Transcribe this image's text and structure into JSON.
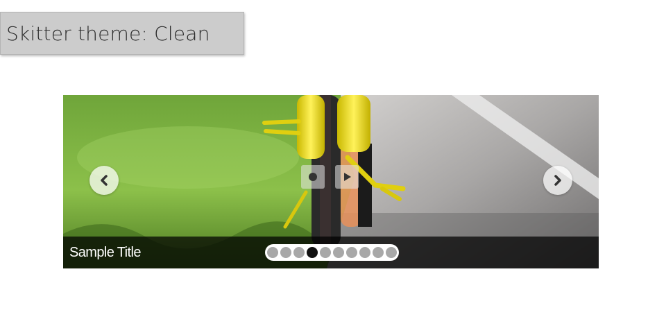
{
  "header": {
    "theme_label": "Skitter theme: Clean"
  },
  "slider": {
    "caption_title": "Sample Title",
    "slide_count": 10,
    "active_slide": 4,
    "icons": {
      "prev": "chevron-left-icon",
      "next": "chevron-right-icon",
      "pause": "pause-icon",
      "play": "play-icon"
    }
  },
  "colors": {
    "label_bg": "#cccccc",
    "caption_bg": "#000000",
    "dot_active": "#111111",
    "dot_inactive": "#a8a8a8"
  }
}
